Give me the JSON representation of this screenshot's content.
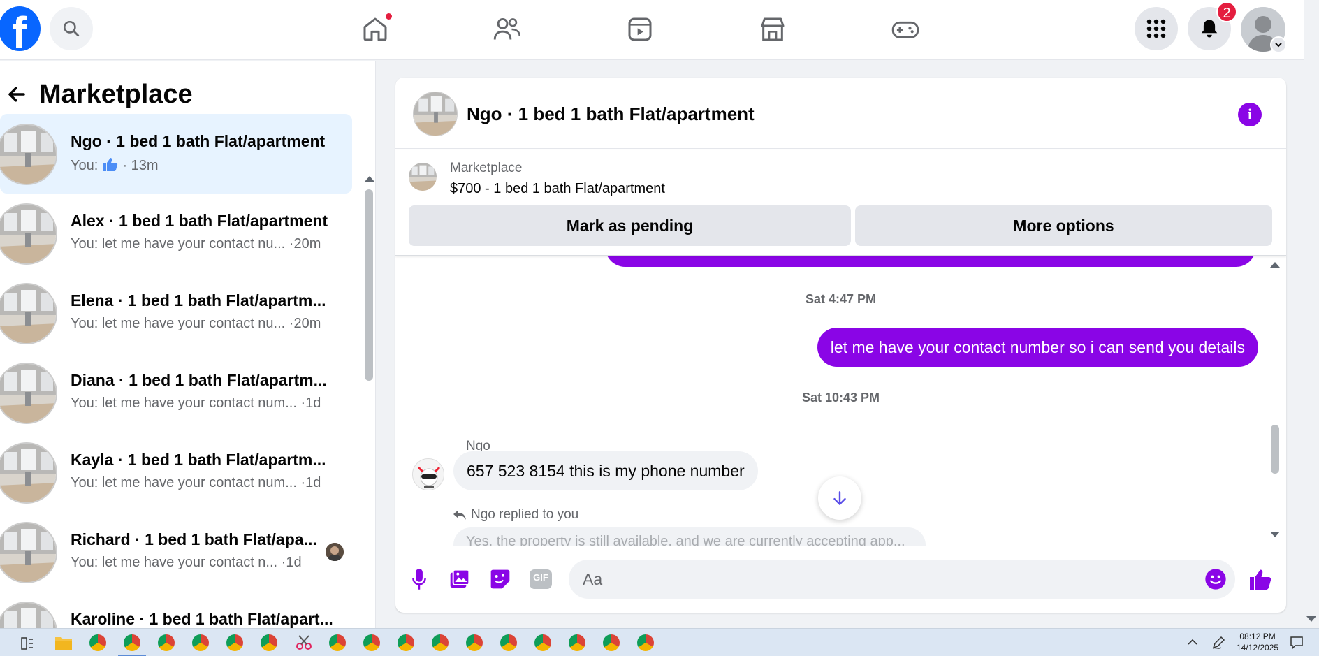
{
  "topbar": {
    "logo": "f",
    "icons": [
      "facebook-logo-icon",
      "search-icon",
      "home-icon",
      "friends-icon",
      "video-icon",
      "marketplace-icon",
      "gaming-icon",
      "menu-grid-icon",
      "bell-icon",
      "profile-avatar"
    ],
    "notification_count": "2",
    "accent": "#0866ff"
  },
  "sidebar": {
    "title": "Marketplace",
    "conversations": [
      {
        "name": "Ngo · 1 bed 1 bath Flat/apartment",
        "sub": "You: ",
        "time": "· 13m"
      },
      {
        "name": "Alex · 1 bed 1 bath Flat/apartment",
        "sub": "You: let me have your contact nu...",
        "time": "·20m"
      },
      {
        "name": "Elena · 1 bed 1 bath Flat/apartm...",
        "sub": "You: let me have your contact nu...",
        "time": "·20m"
      },
      {
        "name": "Diana · 1 bed 1 bath Flat/apartm...",
        "sub": "You: let me have your contact num...",
        "time": "·1d"
      },
      {
        "name": "Kayla · 1 bed 1 bath Flat/apartm...",
        "sub": "You: let me have your contact num...",
        "time": "·1d"
      },
      {
        "name": "Richard · 1 bed 1 bath Flat/apa...",
        "sub": "You: let me have your contact n...",
        "time": "·1d"
      },
      {
        "name": "Karoline · 1 bed 1 bath Flat/apart...",
        "sub": "",
        "time": ""
      }
    ]
  },
  "chat": {
    "title": "Ngo · 1 bed 1 bath Flat/apartment",
    "listing_label": "Marketplace",
    "listing_price": "$700 - 1 bed 1 bath Flat/apartment",
    "mark_pending": "Mark as pending",
    "more_options": "More options",
    "timestamp1": "Sat 4:47 PM",
    "outgoing_message": "let me have your contact number so i can send you details",
    "timestamp2": "Sat 10:43 PM",
    "sender_name": "Ngo",
    "incoming_message": "657 523 8154 this is my phone number",
    "replied_label": "Ngo replied to you",
    "reply_preview": "Yes, the property is still available, and we are currently accepting app...",
    "composer_placeholder": "Aa",
    "gif_label": "GIF",
    "message_color": "#8a05e6"
  },
  "taskbar": {
    "time": "08:12 PM",
    "date": "14/12/2025"
  }
}
